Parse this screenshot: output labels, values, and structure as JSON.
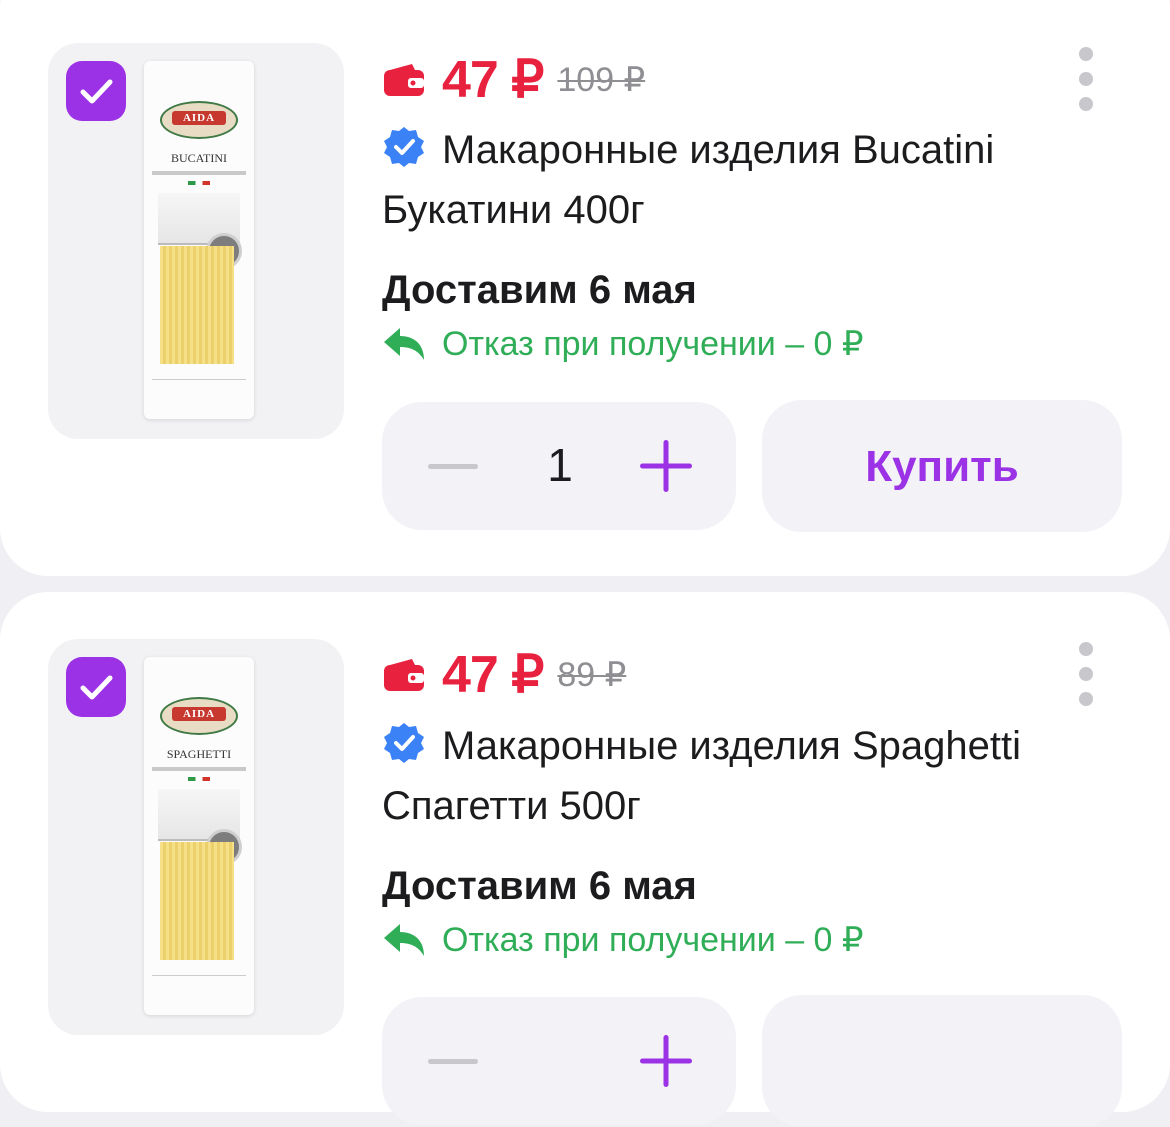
{
  "products": [
    {
      "checked": true,
      "pack_brand": "AIDA",
      "pack_name": "BUCATINI",
      "price_current": "47 ₽",
      "price_old": "109 ₽",
      "title": "Макаронные изделия Bucatini Букатини 400г",
      "delivery": "Доставим 6 мая",
      "refusal": "Отказ при получении – 0 ₽",
      "quantity": "1",
      "buy_label": "Купить"
    },
    {
      "checked": true,
      "pack_brand": "AIDA",
      "pack_name": "SPAGHETTI",
      "price_current": "47 ₽",
      "price_old": "89 ₽",
      "title": "Макаронные изделия Spaghetti Спагетти 500г",
      "delivery": "Доставим 6 мая",
      "refusal": "Отказ при получении – 0 ₽",
      "quantity": "",
      "buy_label": ""
    }
  ],
  "icons": {
    "checkbox": "checkmark-icon",
    "wallet": "wallet-icon",
    "more": "more-vertical-icon",
    "verified": "verified-badge-icon",
    "return": "return-arrow-icon",
    "minus": "minus-icon",
    "plus": "plus-icon"
  },
  "colors": {
    "accent": "#9b32e6",
    "price": "#e8213f",
    "refusal": "#2fad57",
    "verified": "#3b82f6",
    "background": "#efeff4"
  }
}
